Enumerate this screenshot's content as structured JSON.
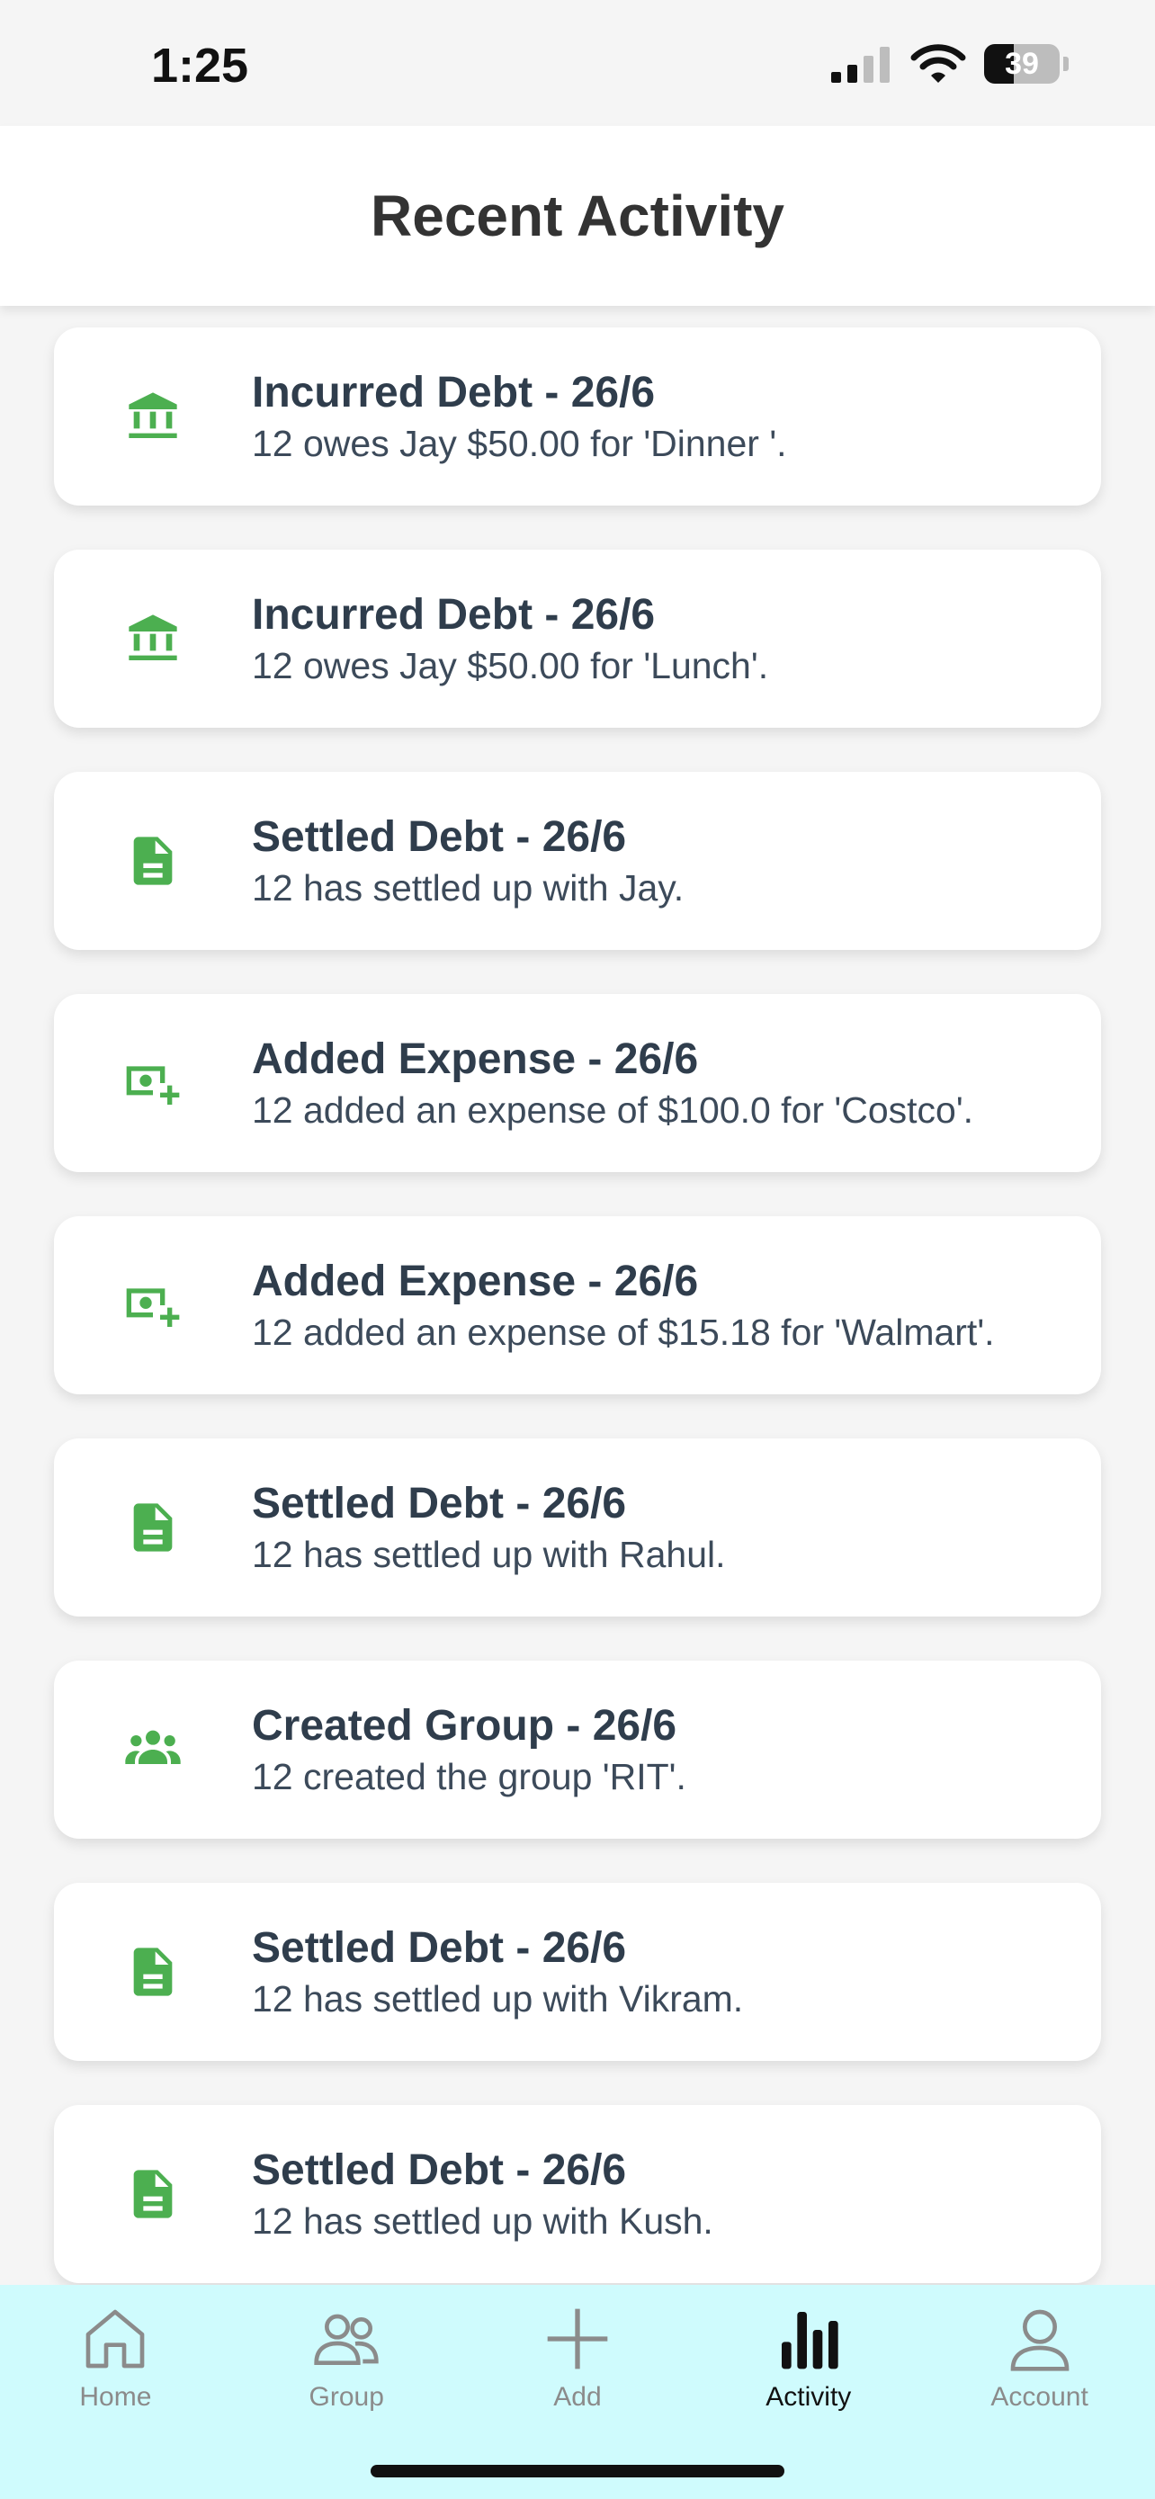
{
  "status_bar": {
    "time": "1:25",
    "battery": "39"
  },
  "header": {
    "title": "Recent Activity"
  },
  "activities": [
    {
      "icon": "bank-icon",
      "title": "Incurred Debt - 26/6",
      "description": "12 owes Jay $50.00 for 'Dinner '."
    },
    {
      "icon": "bank-icon",
      "title": "Incurred Debt - 26/6",
      "description": "12 owes Jay $50.00 for 'Lunch'."
    },
    {
      "icon": "document-icon",
      "title": "Settled Debt - 26/6",
      "description": "12 has settled up with Jay."
    },
    {
      "icon": "cash-plus-icon",
      "title": "Added Expense - 26/6",
      "description": "12 added an expense of $100.0 for 'Costco'."
    },
    {
      "icon": "cash-plus-icon",
      "title": "Added Expense - 26/6",
      "description": "12 added an expense of $15.18 for 'Walmart'."
    },
    {
      "icon": "document-icon",
      "title": "Settled Debt - 26/6",
      "description": "12 has settled up with Rahul."
    },
    {
      "icon": "group-icon",
      "title": "Created Group - 26/6",
      "description": "12 created the group 'RIT'."
    },
    {
      "icon": "document-icon",
      "title": "Settled Debt - 26/6",
      "description": "12 has settled up with Vikram."
    },
    {
      "icon": "document-icon",
      "title": "Settled Debt - 26/6",
      "description": "12 has settled up with Kush."
    }
  ],
  "bottom_nav": {
    "items": [
      {
        "label": "Home",
        "icon": "home-icon"
      },
      {
        "label": "Group",
        "icon": "people-icon"
      },
      {
        "label": "Add",
        "icon": "plus-icon"
      },
      {
        "label": "Activity",
        "icon": "bar-chart-icon"
      },
      {
        "label": "Account",
        "icon": "person-icon"
      }
    ],
    "active": "Activity"
  },
  "colors": {
    "accent_green": "#4caf50",
    "nav_background": "#cffbfd",
    "card_background": "#ffffff",
    "page_background": "#f5f5f5",
    "title_text": "#2f3d4c"
  }
}
